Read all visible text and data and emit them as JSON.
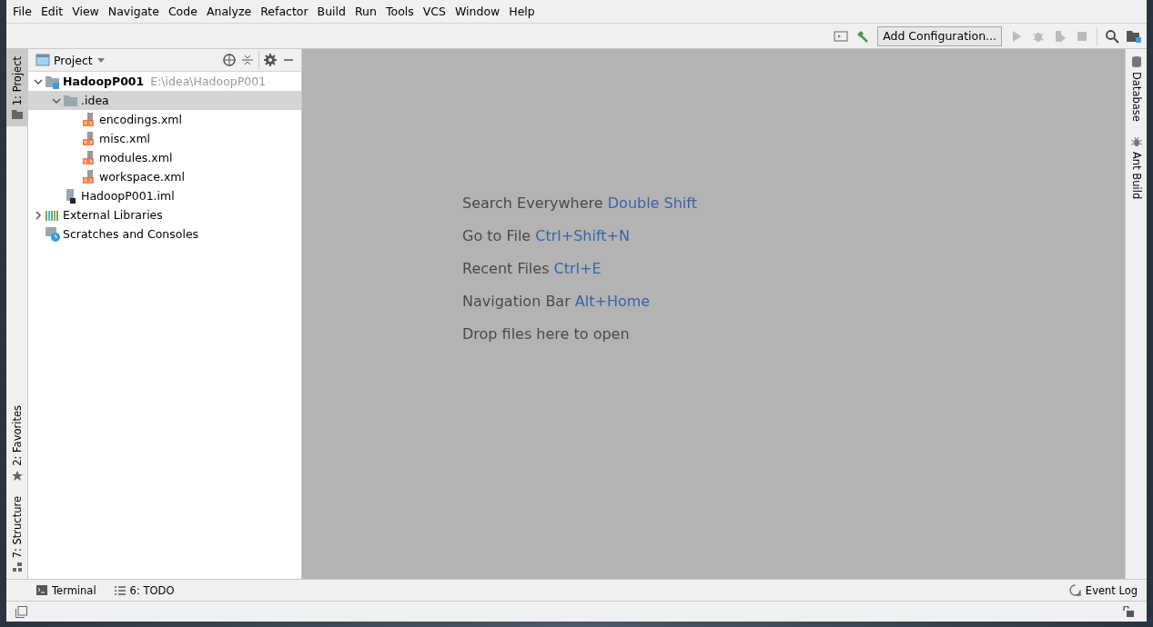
{
  "menu": [
    "File",
    "Edit",
    "View",
    "Navigate",
    "Code",
    "Analyze",
    "Refactor",
    "Build",
    "Run",
    "Tools",
    "VCS",
    "Window",
    "Help"
  ],
  "toolbar": {
    "configuration": "Add Configuration..."
  },
  "left_tool_tabs": [
    {
      "label": "1: Project",
      "selected": true,
      "kind": "folder"
    },
    {
      "label": "2: Favorites",
      "selected": false,
      "kind": "star"
    },
    {
      "label": "7: Structure",
      "selected": false,
      "kind": "structure"
    }
  ],
  "project_panel": {
    "title": "Project",
    "tree": [
      {
        "name": "HadoopP001",
        "path": "E:\\idea\\HadoopP001",
        "kind": "module",
        "expanded": true,
        "selected": false,
        "children": [
          {
            "name": ".idea",
            "kind": "folder",
            "expanded": true,
            "selected": true,
            "children": [
              {
                "name": "encodings.xml",
                "kind": "xml",
                "selected": false
              },
              {
                "name": "misc.xml",
                "kind": "xml",
                "selected": false
              },
              {
                "name": "modules.xml",
                "kind": "xml",
                "selected": false
              },
              {
                "name": "workspace.xml",
                "kind": "xml",
                "selected": false
              }
            ]
          },
          {
            "name": "HadoopP001.iml",
            "kind": "iml",
            "selected": false
          }
        ]
      },
      {
        "name": "External Libraries",
        "kind": "libraries",
        "expanded": false,
        "selected": false
      },
      {
        "name": "Scratches and Consoles",
        "kind": "scratches",
        "selected": false
      }
    ]
  },
  "editor_hints": [
    {
      "label": "Search Everywhere",
      "shortcut": "Double Shift"
    },
    {
      "label": "Go to File",
      "shortcut": "Ctrl+Shift+N"
    },
    {
      "label": "Recent Files",
      "shortcut": "Ctrl+E"
    },
    {
      "label": "Navigation Bar",
      "shortcut": "Alt+Home"
    },
    {
      "label": "Drop files here to open"
    }
  ],
  "right_tool_tabs": [
    {
      "label": "Database",
      "kind": "database"
    },
    {
      "label": "Ant Build",
      "kind": "ant"
    }
  ],
  "bottom_tool_tabs": [
    {
      "label": "Terminal",
      "kind": "terminal"
    },
    {
      "label": "6: TODO",
      "kind": "todo"
    }
  ],
  "event_log": "Event Log"
}
